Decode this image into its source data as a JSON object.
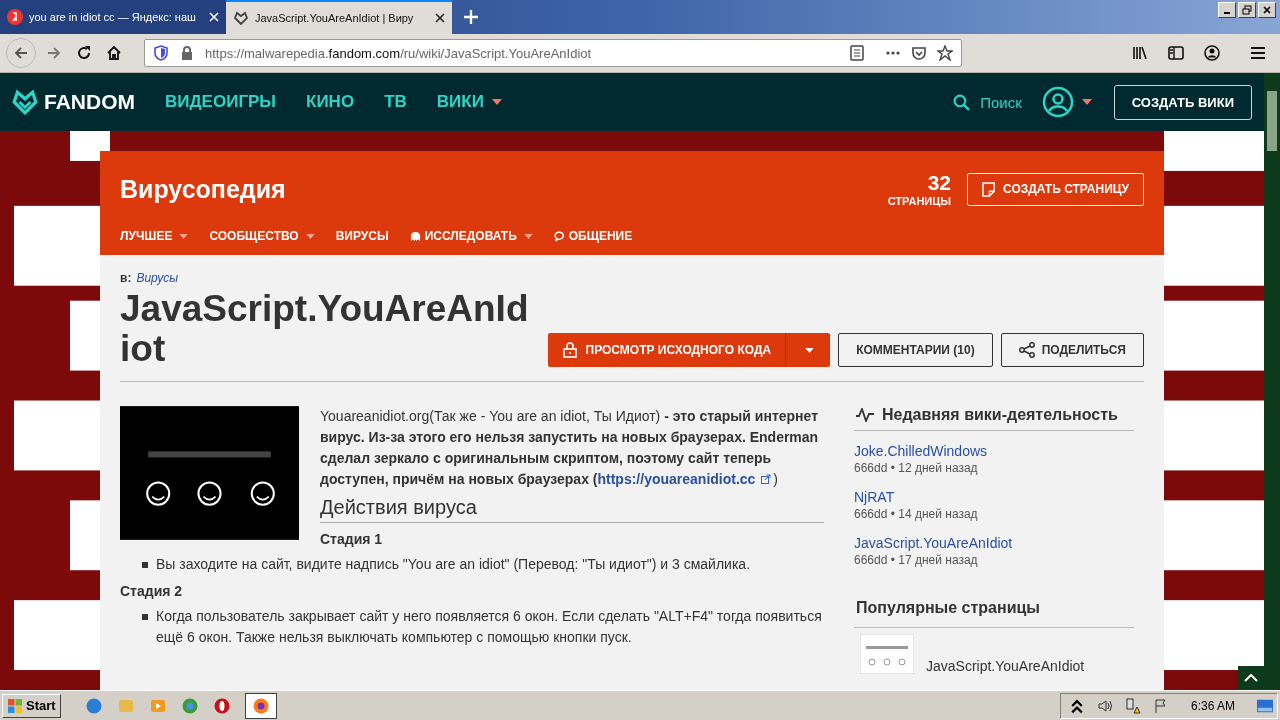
{
  "browser": {
    "tabs": [
      {
        "title": "you are in idiot cc — Яндекс: наш",
        "selected": false
      },
      {
        "title": "JavaScript.YouAreAnIdiot | Виру",
        "selected": true
      }
    ],
    "url_scheme": "https://malwarepedia.",
    "url_host": "fandom.com",
    "url_path": "/ru/wiki/JavaScript.YouAreAnIdiot"
  },
  "fandom_nav": {
    "logo": "FANDOM",
    "items": [
      {
        "label": "ВИДЕОИГРЫ",
        "dropdown": false
      },
      {
        "label": "КИНО",
        "dropdown": false
      },
      {
        "label": "ТВ",
        "dropdown": false
      },
      {
        "label": "ВИКИ",
        "dropdown": true
      }
    ],
    "search": "Поиск",
    "create_wiki": "СОЗДАТЬ ВИКИ"
  },
  "wiki": {
    "name": "Вирусопедия",
    "page_count": "32",
    "page_count_label": "СТРАНИЦЫ",
    "create_page": "СОЗДАТЬ СТРАНИЦУ",
    "nav": [
      {
        "label": "ЛУЧШЕЕ",
        "kind": "plain",
        "dropdown": true
      },
      {
        "label": "СООБЩЕСТВО",
        "kind": "plain",
        "dropdown": true
      },
      {
        "label": "ВИРУСЫ",
        "kind": "plain",
        "dropdown": false
      },
      {
        "label": "ИССЛЕДОВАТЬ",
        "kind": "explore",
        "dropdown": true
      },
      {
        "label": "ОБЩЕНИЕ",
        "kind": "chat",
        "dropdown": false
      }
    ]
  },
  "article": {
    "category_label": "в:",
    "category": "Вирусы",
    "title": "JavaScript.YouAreAnIdiot",
    "view_source": "ПРОСМОТР ИСХОДНОГО КОДА",
    "comments": "КОММЕНТАРИИ (10)",
    "share": "ПОДЕЛИТЬСЯ",
    "intro": "Youareanidiot.org(Так же - You are an idiot, Ты Идиот) **- это старый интернет вирус. Из-за этого его нельзя запустить на новых браузерах. Enderman сделал зеркало с оригинальным скриптом, поэтому сайт теперь доступен, причём на новых браузерах (**",
    "intro_link": "https://youareanidiot.cc",
    "intro_end": ")",
    "section": "Действия вируса",
    "stages": [
      {
        "heading": "Стадия 1",
        "items": [
          "Вы заходите на сайт, видите надпись \"You are an idiot\" (Перевод: \"Ты идиот\") и 3 смайлика."
        ]
      },
      {
        "heading": "Стадия 2",
        "items": [
          "Когда пользователь закрывает сайт у него появляется 6 окон. Если сделать \"ALT+F4\" тогда появиться ещё 6 окон. Также нельзя выключать компьютер с помощью кнопки пуск."
        ]
      }
    ]
  },
  "sidebar": {
    "recent_title": "Недавняя вики-деятельность",
    "recent": [
      {
        "title": "Joke.ChilledWindows",
        "meta": "666dd • 12 дней назад"
      },
      {
        "title": "NjRAT",
        "meta": "666dd • 14 дней назад"
      },
      {
        "title": "JavaScript.YouAreAnIdiot",
        "meta": "666dd • 17 дней назад"
      }
    ],
    "popular_title": "Популярные страницы",
    "popular": [
      {
        "title": "JavaScript.YouAreAnIdiot"
      }
    ]
  },
  "taskbar": {
    "start": "Start",
    "apps": [
      {
        "kind": "ie",
        "selected": false
      },
      {
        "kind": "explorer",
        "selected": false
      },
      {
        "kind": "media",
        "selected": false
      },
      {
        "kind": "chrome",
        "selected": false
      },
      {
        "kind": "opera",
        "selected": false
      },
      {
        "kind": "firefox",
        "selected": true
      }
    ],
    "time": "6:36 AM"
  }
}
